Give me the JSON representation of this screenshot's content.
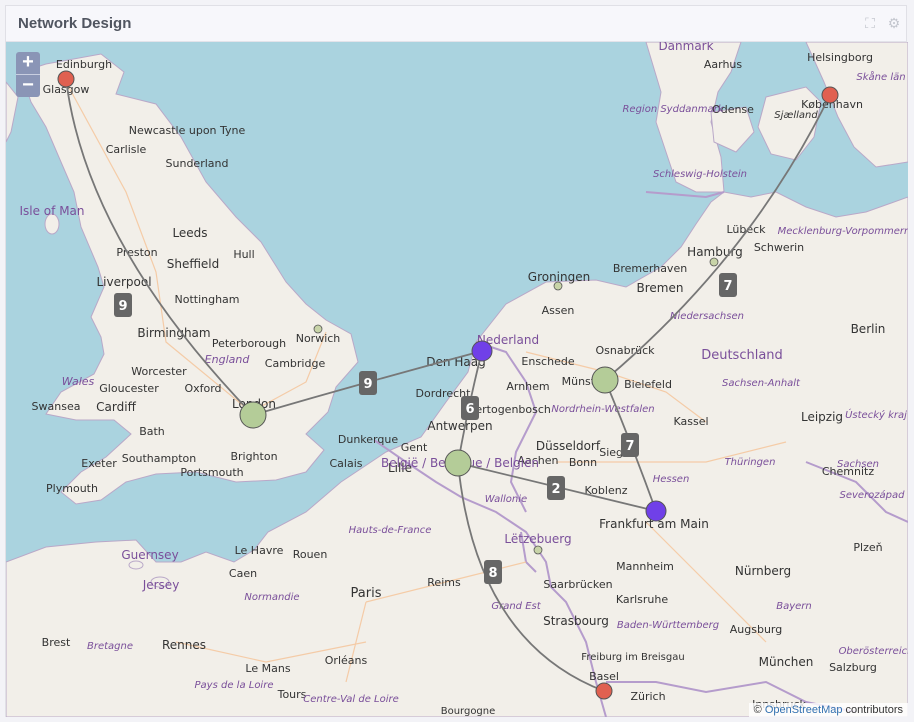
{
  "panel": {
    "title": "Network Design"
  },
  "map": {
    "zoom_in_label": "+",
    "zoom_out_label": "−",
    "attribution": {
      "prefix": "© ",
      "link_text": "OpenStreetMap",
      "suffix": " contributors"
    },
    "colors": {
      "sea": "#aad3df",
      "land": "#f2efe9",
      "route": "#777777",
      "label_badge": "#666666",
      "node_red": "#e06050",
      "node_blue": "#7040e8",
      "node_green": "#b4cc98",
      "node_small": "#c8d4a8"
    },
    "place_labels": [
      "Edinburgh",
      "Glasgow",
      "Newcastle upon Tyne",
      "Carlisle",
      "Sunderland",
      "Isle of Man",
      "Leeds",
      "Preston",
      "Sheffield",
      "Hull",
      "Liverpool",
      "Nottingham",
      "Birmingham",
      "Peterborough",
      "Norwich",
      "England",
      "Cambridge",
      "Wales",
      "Worcester",
      "Gloucester",
      "Oxford",
      "Swansea",
      "Cardiff",
      "London",
      "Bath",
      "Exeter",
      "Southampton",
      "Brighton",
      "Portsmouth",
      "Plymouth",
      "Guernsey",
      "Jersey",
      "Dunkerque",
      "Calais",
      "Lille",
      "Gent",
      "Antwerpen",
      "Den Haag",
      "Nederland",
      "Dordrecht",
      "Hertogenbosch",
      "Arnhem",
      "Enschede",
      "Groningen",
      "Assen",
      "Bremerhaven",
      "Bremen",
      "Hamburg",
      "Lübeck",
      "Schwerin",
      "Osnabrück",
      "Münster",
      "Bielefeld",
      "Deutschland",
      "Berlin",
      "Düsseldorf",
      "Aachen",
      "Bonn",
      "Siegen",
      "Koblenz",
      "Kassel",
      "Leipzig",
      "Chemnitz",
      "Frankfurt am Main",
      "Mannheim",
      "Nürnberg",
      "Saarbrücken",
      "Karlsruhe",
      "Strasbourg",
      "Augsburg",
      "München",
      "Freiburg im Breisgau",
      "Basel",
      "Zürich",
      "Innsbruck",
      "Salzburg",
      "Paris",
      "Le Havre",
      "Rouen",
      "Caen",
      "Reims",
      "Rennes",
      "Brest",
      "Le Mans",
      "Orléans",
      "Tours",
      "Lëtzebuerg",
      "Danmark",
      "Aarhus",
      "Odense",
      "Helsingborg",
      "København",
      "Sjælland",
      "Region Syddanmark",
      "Skåne län",
      "Schleswig-Holstein",
      "Mecklenburg-Vorpommern",
      "Niedersachsen",
      "Nordrhein-Westfalen",
      "Sachsen-Anhalt",
      "Hessen",
      "Thüringen",
      "Sachsen",
      "Baden-Württemberg",
      "Bayern",
      "Grand Est",
      "Hauts-de-France",
      "Normandie",
      "Bretagne",
      "Pays de la Loire",
      "Centre-Val de Loire",
      "Wallonie",
      "België / Belgique / Belgien",
      "Plzeň",
      "Ústecký kraj",
      "Severozápad",
      "Oberösterreich",
      "Bourgogne"
    ],
    "nodes": [
      {
        "name": "Glasgow",
        "kind": "red"
      },
      {
        "name": "København",
        "kind": "red"
      },
      {
        "name": "Basel",
        "kind": "red"
      },
      {
        "name": "Nederland",
        "kind": "blue"
      },
      {
        "name": "Frankfurt am Main",
        "kind": "blue"
      },
      {
        "name": "London",
        "kind": "green"
      },
      {
        "name": "Münster",
        "kind": "green"
      },
      {
        "name": "België / Belgique / Belgien",
        "kind": "green"
      }
    ],
    "routes": [
      {
        "from": "Glasgow",
        "to": "London",
        "label": "9"
      },
      {
        "from": "London",
        "to": "Nederland",
        "label": "9"
      },
      {
        "from": "Nederland",
        "to": "België / Belgique / Belgien",
        "label": "6"
      },
      {
        "from": "België / Belgique / Belgien",
        "to": "Frankfurt am Main",
        "label": "2"
      },
      {
        "from": "Münster",
        "to": "Frankfurt am Main",
        "label": "7"
      },
      {
        "from": "Münster",
        "to": "København",
        "label": "7"
      },
      {
        "from": "België / Belgique / Belgien",
        "to": "Basel",
        "label": "8"
      }
    ]
  }
}
